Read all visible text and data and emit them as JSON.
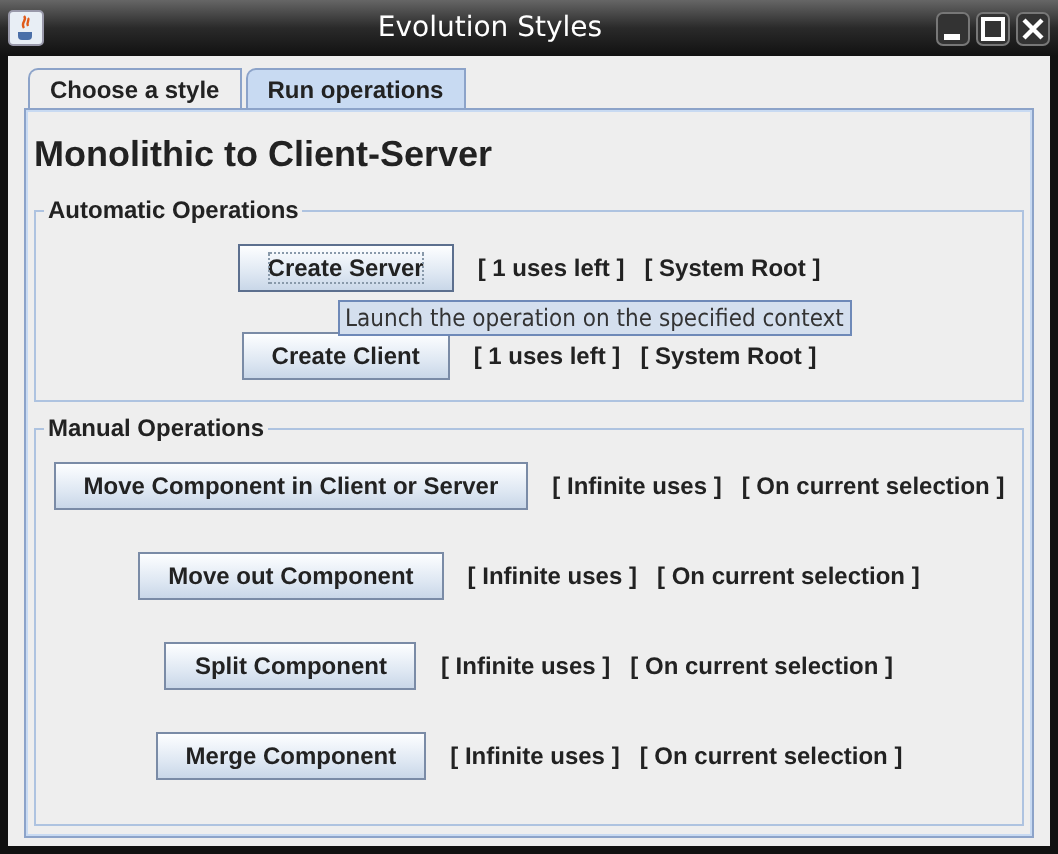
{
  "window": {
    "title": "Evolution Styles"
  },
  "tabs": [
    {
      "label": "Choose a style",
      "selected": false
    },
    {
      "label": "Run operations",
      "selected": true
    }
  ],
  "heading": "Monolithic to Client-Server",
  "groups": [
    {
      "title": "Automatic Operations",
      "operations": [
        {
          "button": "Create Server",
          "focused": true,
          "uses": "[ 1 uses left ]",
          "context": "[ System Root ]",
          "tooltip": "Launch the operation on the specified context"
        },
        {
          "button": "Create Client",
          "focused": false,
          "uses": "[ 1 uses left ]",
          "context": "[ System Root ]"
        }
      ]
    },
    {
      "title": "Manual Operations",
      "operations": [
        {
          "button": "Move Component in Client or Server",
          "focused": false,
          "uses": "[ Infinite uses ]",
          "context": "[ On current selection ]"
        },
        {
          "button": "Move out Component",
          "focused": false,
          "uses": "[ Infinite uses ]",
          "context": "[ On current selection ]"
        },
        {
          "button": "Split Component",
          "focused": false,
          "uses": "[ Infinite uses ]",
          "context": "[ On current selection ]"
        },
        {
          "button": "Merge Component",
          "focused": false,
          "uses": "[ Infinite uses ]",
          "context": "[ On current selection ]"
        }
      ]
    }
  ]
}
